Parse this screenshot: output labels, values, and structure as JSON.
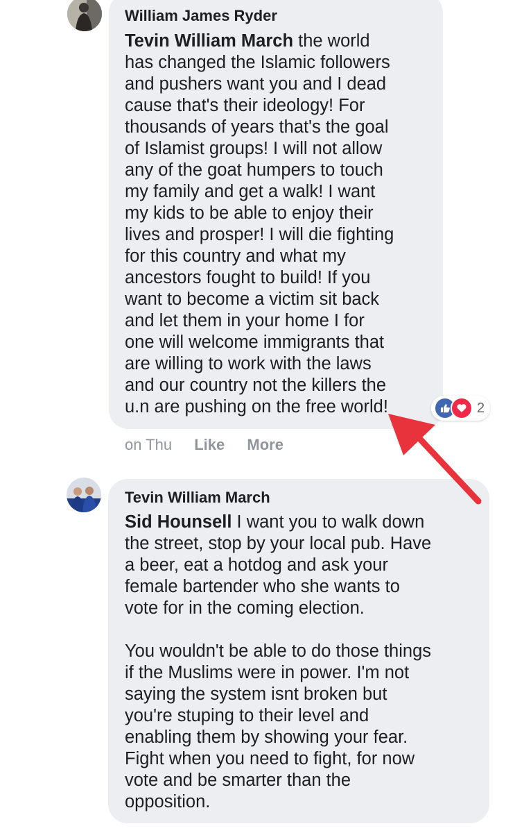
{
  "comments": [
    {
      "author": "William James Ryder",
      "mention": "Tevin William March",
      "text": " the world\nhas changed the Islamic followers\nand pushers want you and I dead\ncause that's their ideology! For\nthousands of years that's the goal\nof Islamist groups! I will not allow\nany of the goat humpers to touch\nmy family and get a walk! I want\nmy kids to be able to enjoy their\nlives and prosper! I will die fighting\nfor this country and what my\nancestors fought to build! If you\nwant to become a victim sit back\nand let them in your home I for\none will welcome immigrants that\nare willing to work with the laws\nand our country not the killers the\nu.n are pushing on the free world!",
      "timestamp": "on Thu",
      "like_label": "Like",
      "more_label": "More",
      "reaction_count": "2",
      "reactions": [
        "like-icon",
        "love-icon"
      ]
    },
    {
      "author": "Tevin William March",
      "mention": "Sid Hounsell",
      "text": " I want you to walk down\nthe street, stop by your local pub. Have\na beer, eat a hotdog and ask your\nfemale bartender who she wants to\nvote for in the coming election.\n\nYou wouldn't be able to do those things\nif the Muslims were in power. I'm not\nsaying the system isnt broken but\nyou're stuping to their level and\nenabling them by showing your fear.\nFight when you need to fight, for now\nvote and be smarter than the\nopposition."
    }
  ],
  "annotation": {
    "color": "#e8323c"
  },
  "colors": {
    "bubble": "#eceef1",
    "meta": "#90949c",
    "like": "#4267b2",
    "love": "#f0284a"
  }
}
